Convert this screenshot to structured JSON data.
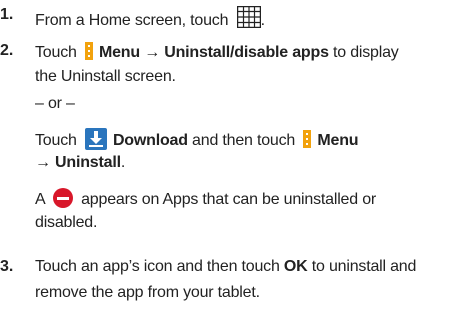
{
  "steps": [
    {
      "number": "1.",
      "text_a": "From a Home screen, touch",
      "text_b": "."
    },
    {
      "number": "2.",
      "line1_a": "Touch",
      "line1_menu": "Menu",
      "line1_arrow": "→ Uninstall/disable apps",
      "line1_b": "to display",
      "line2": "the Uninstall screen.",
      "or": "– or –",
      "line3_a": "Touch",
      "line3_download": "Download",
      "line3_b": "and then touch",
      "line3_menu": "Menu",
      "line4_bold": "→ Uninstall",
      "line4_end": ".",
      "note1_a": "A",
      "note1_b": "appears on Apps that can be uninstalled or",
      "note2": "disabled."
    },
    {
      "number": "3.",
      "line1_a": "Touch an app’s icon and then touch",
      "line1_ok": "OK",
      "line1_b": "to uninstall and",
      "line2": "remove the app from your tablet."
    }
  ],
  "icons": {
    "apps_grid": "apps-grid-icon",
    "menu": "menu-icon",
    "download": "download-icon",
    "minus": "uninstall-minus-icon"
  },
  "colors": {
    "menu_icon": "#f2a20d",
    "download_icon": "#2a75bd",
    "minus_icon": "#d8172a"
  }
}
